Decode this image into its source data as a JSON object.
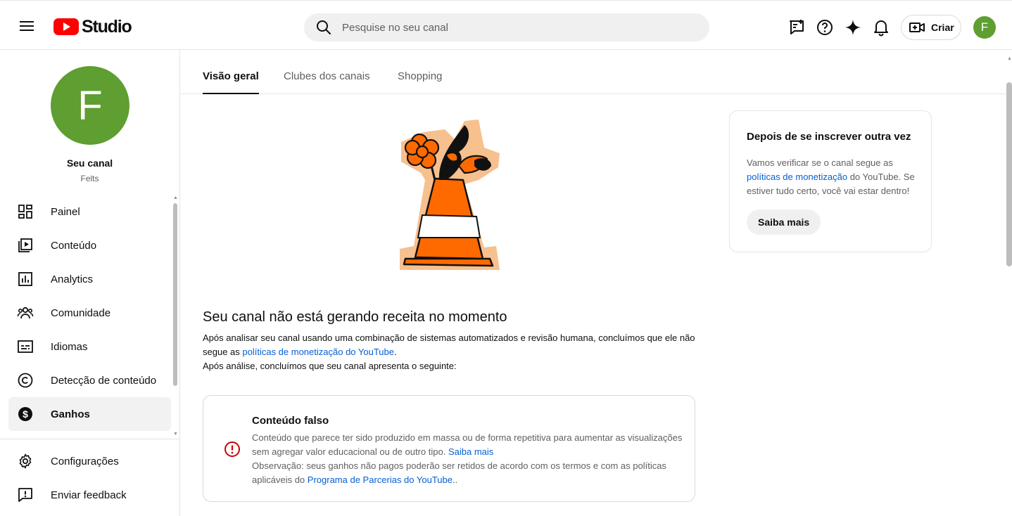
{
  "header": {
    "logo_text": "Studio",
    "search_placeholder": "Pesquise no seu canal",
    "create_label": "Criar",
    "avatar_initial": "F"
  },
  "sidebar": {
    "avatar_initial": "F",
    "channel_title": "Seu canal",
    "channel_handle": "Felts",
    "items": [
      {
        "label": "Painel",
        "icon": "dashboard-icon"
      },
      {
        "label": "Conteúdo",
        "icon": "content-icon"
      },
      {
        "label": "Analytics",
        "icon": "analytics-icon"
      },
      {
        "label": "Comunidade",
        "icon": "community-icon"
      },
      {
        "label": "Idiomas",
        "icon": "subtitles-icon"
      },
      {
        "label": "Detecção de conteúdo",
        "icon": "copyright-icon"
      },
      {
        "label": "Ganhos",
        "icon": "dollar-icon",
        "active": true
      }
    ],
    "bottom_items": [
      {
        "label": "Configurações",
        "icon": "gear-icon"
      },
      {
        "label": "Enviar feedback",
        "icon": "feedback-icon"
      }
    ]
  },
  "tabs": [
    {
      "label": "Visão geral",
      "active": true
    },
    {
      "label": "Clubes dos canais"
    },
    {
      "label": "Shopping"
    }
  ],
  "status": {
    "headline": "Seu canal não está gerando receita no momento",
    "para1_text": "Após analisar seu canal usando uma combinação de sistemas automatizados e revisão humana, concluímos que ele não segue as ",
    "para1_link": "políticas de monetização do YouTube",
    "para1_end": ".",
    "para2": "Após análise, concluímos que seu canal apresenta o seguinte:"
  },
  "issue": {
    "title": "Conteúdo falso",
    "text1": "Conteúdo que parece ter sido produzido em massa ou de forma repetitiva para aumentar as visualizações sem agregar valor educacional ou de outro tipo. ",
    "link1": "Saiba mais",
    "text2": "Observação: seus ganhos não pagos poderão ser retidos de acordo com os termos e com as políticas aplicáveis do ",
    "link2": "Programa de Parcerias do YouTube",
    "text3": ".."
  },
  "side_card": {
    "title": "Depois de se inscrever outra vez",
    "text1": "Vamos verificar se o canal segue as ",
    "link": "políticas de monetização",
    "text2": " do YouTube. Se estiver tudo certo, você vai estar dentro!",
    "button": "Saiba mais"
  },
  "colors": {
    "accent_link": "#065fd4",
    "avatar": "#5f9e31",
    "brand_red": "#ff0000",
    "error": "#cc0000",
    "cone_orange": "#ff6a00"
  }
}
